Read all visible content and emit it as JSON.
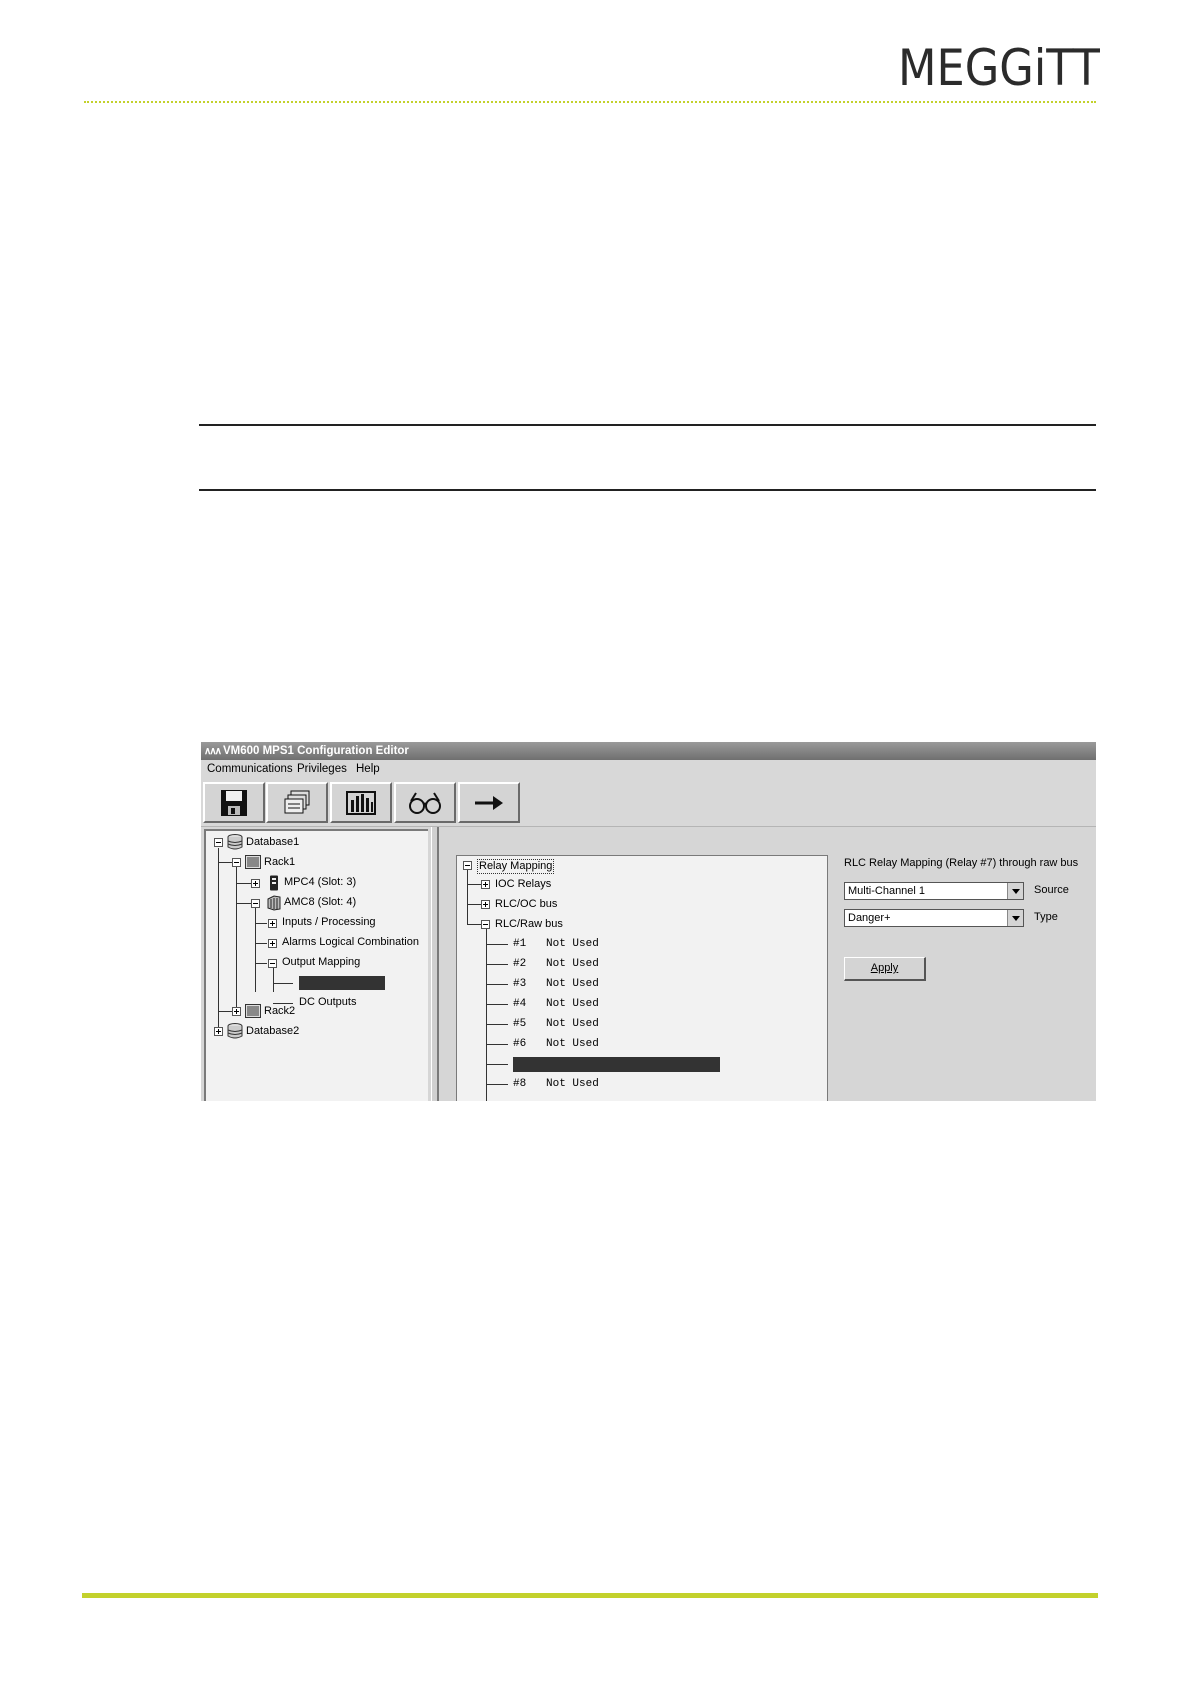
{
  "header": {
    "logo_text": "MEGGiTT",
    "brand_color": "#c3d12c"
  },
  "window": {
    "title": "VM600 MPS1 Configuration Editor",
    "menu": [
      "Communications",
      "Privileges",
      "Help"
    ],
    "toolbar_icons": [
      "save-icon",
      "cards-icon",
      "rack-icon",
      "glasses-icon",
      "arrow-right-icon"
    ]
  },
  "left_tree": {
    "database1": "Database1",
    "rack1": "Rack1",
    "mpc4": "MPC4 (Slot:  3)",
    "amc8": "AMC8 (Slot:  4)",
    "inputs": "Inputs / Processing",
    "alarms": "Alarms Logical Combination",
    "output_mapping": "Output Mapping",
    "dc_outputs": "DC Outputs",
    "rack2": "Rack2",
    "database2": "Database2"
  },
  "mid_tree": {
    "relay_mapping": "Relay Mapping",
    "ioc_relays": "IOC Relays",
    "rlc_oc_bus": "RLC/OC bus",
    "rlc_raw_bus": "RLC/Raw bus",
    "relays": [
      {
        "num": "#1",
        "value": "Not Used"
      },
      {
        "num": "#2",
        "value": "Not Used"
      },
      {
        "num": "#3",
        "value": "Not Used"
      },
      {
        "num": "#4",
        "value": "Not Used"
      },
      {
        "num": "#5",
        "value": "Not Used"
      },
      {
        "num": "#6",
        "value": "Not Used"
      },
      {
        "num": "#8",
        "value": "Not Used"
      }
    ]
  },
  "right_panel": {
    "heading": "RLC Relay Mapping (Relay #7) through raw bus",
    "source_value": "Multi-Channel 1",
    "source_label": "Source",
    "type_value": "Danger+",
    "type_label": "Type",
    "apply_label": "Apply"
  }
}
